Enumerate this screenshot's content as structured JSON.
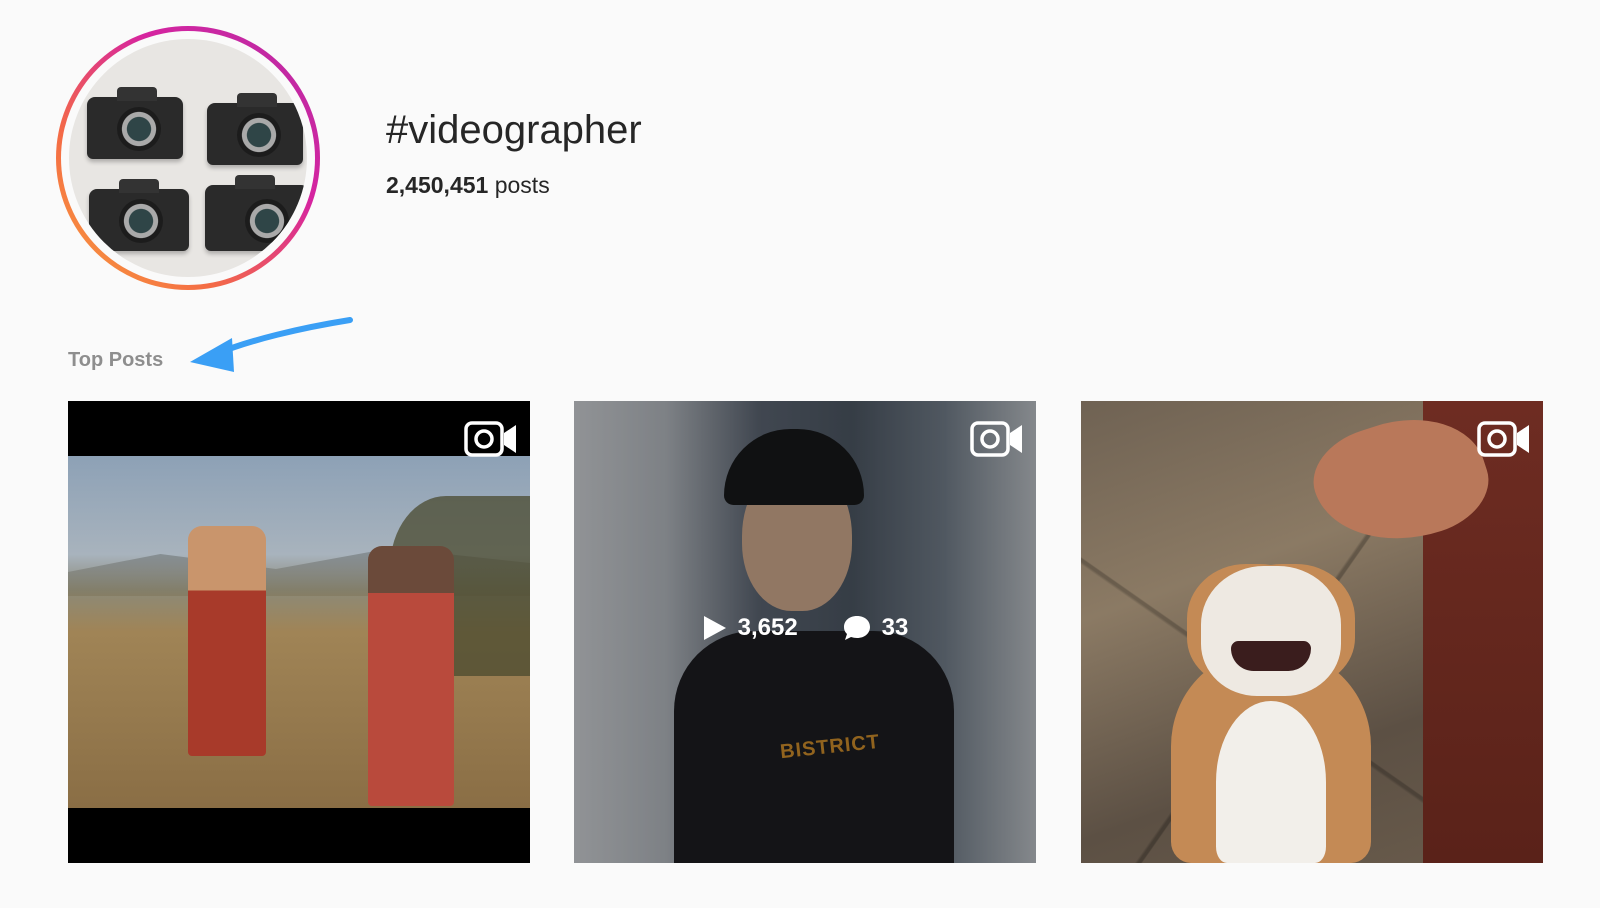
{
  "header": {
    "hashtag": "#videographer",
    "post_count": "2,450,451",
    "post_count_suffix": "posts"
  },
  "sections": {
    "top_posts_label": "Top Posts"
  },
  "posts": [
    {
      "type": "video",
      "icon": "video-camera-icon"
    },
    {
      "type": "video",
      "icon": "video-camera-icon",
      "views": "3,652",
      "comments": "33",
      "shirt_text": "BISTRICT"
    },
    {
      "type": "video",
      "icon": "video-camera-icon"
    }
  ],
  "colors": {
    "background": "#fafafa",
    "text": "#262626",
    "muted": "#8e8e8e",
    "annotation_arrow": "#3a9ff5"
  }
}
